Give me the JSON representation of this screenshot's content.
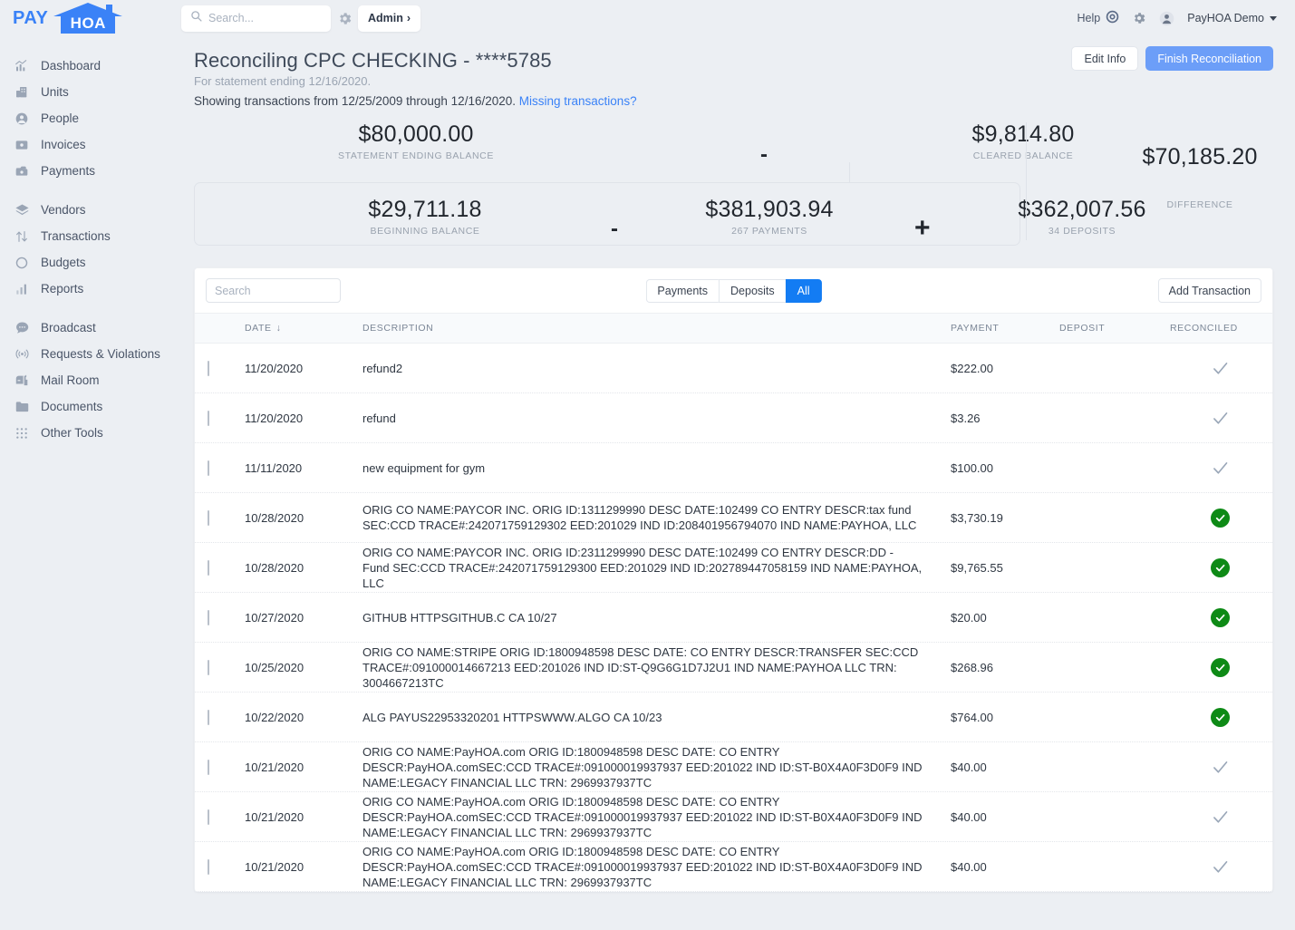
{
  "brand": {
    "pay": "PAY",
    "hoa": "HOA"
  },
  "topbar": {
    "search_placeholder": "Search...",
    "admin_label": "Admin",
    "admin_chevron": "›",
    "help_label": "Help",
    "account_label": "PayHOA Demo"
  },
  "sidebar": {
    "groups": [
      {
        "items": [
          {
            "label": "Dashboard",
            "icon": "dashboard-icon"
          },
          {
            "label": "Units",
            "icon": "units-icon"
          },
          {
            "label": "People",
            "icon": "people-icon"
          },
          {
            "label": "Invoices",
            "icon": "invoices-icon"
          },
          {
            "label": "Payments",
            "icon": "payments-icon"
          }
        ]
      },
      {
        "items": [
          {
            "label": "Vendors",
            "icon": "vendors-icon"
          },
          {
            "label": "Transactions",
            "icon": "transactions-icon"
          },
          {
            "label": "Budgets",
            "icon": "budgets-icon"
          },
          {
            "label": "Reports",
            "icon": "reports-icon"
          }
        ]
      },
      {
        "items": [
          {
            "label": "Broadcast",
            "icon": "broadcast-icon"
          },
          {
            "label": "Requests & Violations",
            "icon": "requests-icon"
          },
          {
            "label": "Mail Room",
            "icon": "mailroom-icon"
          },
          {
            "label": "Documents",
            "icon": "documents-icon"
          },
          {
            "label": "Other Tools",
            "icon": "other-tools-icon"
          }
        ]
      }
    ]
  },
  "page": {
    "title": "Reconciling CPC CHECKING - ****5785",
    "subtitle": "For statement ending 12/16/2020.",
    "showing_text": "Showing transactions from 12/25/2009 through 12/16/2020.",
    "missing_link": "Missing transactions?",
    "edit_info_label": "Edit Info",
    "finish_label": "Finish Reconciliation"
  },
  "summary": {
    "statement_ending_value": "$80,000.00",
    "statement_ending_label": "STATEMENT ENDING BALANCE",
    "op_minus_top": "-",
    "cleared_value": "$9,814.80",
    "cleared_label": "CLEARED BALANCE",
    "beginning_value": "$29,711.18",
    "beginning_label": "BEGINNING BALANCE",
    "op_minus_bottom": "-",
    "payments_value": "$381,903.94",
    "payments_label": "267 PAYMENTS",
    "op_plus": "+",
    "deposits_value": "$362,007.56",
    "deposits_label": "34 DEPOSITS",
    "difference_value": "$70,185.20",
    "difference_label": "DIFFERENCE"
  },
  "toolbar": {
    "search_placeholder": "Search",
    "tabs": [
      {
        "label": "Payments",
        "active": false
      },
      {
        "label": "Deposits",
        "active": false
      },
      {
        "label": "All",
        "active": true
      }
    ],
    "add_transaction_label": "Add Transaction"
  },
  "table": {
    "columns": {
      "date": "DATE",
      "description": "DESCRIPTION",
      "payment": "PAYMENT",
      "deposit": "DEPOSIT",
      "reconciled": "RECONCILED"
    },
    "sort_arrow": "↓",
    "rows": [
      {
        "date": "11/20/2020",
        "description": "refund2",
        "payment": "$222.00",
        "deposit": "",
        "reconciled": "pending"
      },
      {
        "date": "11/20/2020",
        "description": "refund",
        "payment": "$3.26",
        "deposit": "",
        "reconciled": "pending"
      },
      {
        "date": "11/11/2020",
        "description": "new equipment for gym",
        "payment": "$100.00",
        "deposit": "",
        "reconciled": "pending"
      },
      {
        "date": "10/28/2020",
        "description": "ORIG CO NAME:PAYCOR INC. ORIG ID:1311299990 DESC DATE:102499 CO ENTRY DESCR:tax fund SEC:CCD TRACE#:242071759129302 EED:201029 IND ID:208401956794070 IND NAME:PAYHOA, LLC",
        "payment": "$3,730.19",
        "deposit": "",
        "reconciled": "reconciled"
      },
      {
        "date": "10/28/2020",
        "description": "ORIG CO NAME:PAYCOR INC. ORIG ID:2311299990 DESC DATE:102499 CO ENTRY DESCR:DD - Fund SEC:CCD TRACE#:242071759129300 EED:201029 IND ID:202789447058159 IND NAME:PAYHOA, LLC",
        "payment": "$9,765.55",
        "deposit": "",
        "reconciled": "reconciled"
      },
      {
        "date": "10/27/2020",
        "description": "GITHUB HTTPSGITHUB.C CA 10/27",
        "payment": "$20.00",
        "deposit": "",
        "reconciled": "reconciled"
      },
      {
        "date": "10/25/2020",
        "description": "ORIG CO NAME:STRIPE ORIG ID:1800948598 DESC DATE: CO ENTRY DESCR:TRANSFER SEC:CCD TRACE#:091000014667213 EED:201026 IND ID:ST-Q9G6G1D7J2U1 IND NAME:PAYHOA LLC TRN: 3004667213TC",
        "payment": "$268.96",
        "deposit": "",
        "reconciled": "reconciled"
      },
      {
        "date": "10/22/2020",
        "description": "ALG PAYUS22953320201 HTTPSWWW.ALGO CA 10/23",
        "payment": "$764.00",
        "deposit": "",
        "reconciled": "reconciled"
      },
      {
        "date": "10/21/2020",
        "description": "ORIG CO NAME:PayHOA.com ORIG ID:1800948598 DESC DATE: CO ENTRY DESCR:PayHOA.comSEC:CCD TRACE#:091000019937937 EED:201022 IND ID:ST-B0X4A0F3D0F9 IND NAME:LEGACY FINANCIAL LLC TRN: 2969937937TC",
        "payment": "$40.00",
        "deposit": "",
        "reconciled": "pending"
      },
      {
        "date": "10/21/2020",
        "description": "ORIG CO NAME:PayHOA.com ORIG ID:1800948598 DESC DATE: CO ENTRY DESCR:PayHOA.comSEC:CCD TRACE#:091000019937937 EED:201022 IND ID:ST-B0X4A0F3D0F9 IND NAME:LEGACY FINANCIAL LLC TRN: 2969937937TC",
        "payment": "$40.00",
        "deposit": "",
        "reconciled": "pending"
      },
      {
        "date": "10/21/2020",
        "description": "ORIG CO NAME:PayHOA.com ORIG ID:1800948598 DESC DATE: CO ENTRY DESCR:PayHOA.comSEC:CCD TRACE#:091000019937937 EED:201022 IND ID:ST-B0X4A0F3D0F9 IND NAME:LEGACY FINANCIAL LLC TRN: 2969937937TC",
        "payment": "$40.00",
        "deposit": "",
        "reconciled": "pending"
      }
    ]
  },
  "colors": {
    "brand_blue": "#3a82f7",
    "primary_button": "#6c9ef8",
    "active_tab": "#137cf3",
    "reconciled_green": "#0e8a16",
    "sidebar_bg": "#eceff3"
  }
}
